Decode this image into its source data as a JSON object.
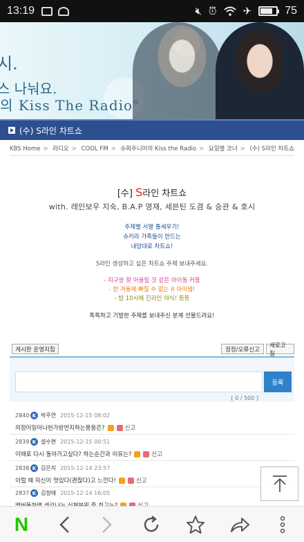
{
  "status_bar": {
    "time": "13:19",
    "battery_level": 75,
    "battery_text": "75",
    "icons": [
      "image-icon",
      "notification-icon",
      "mute-icon",
      "alarm-icon",
      "wifi-icon",
      "airplane-icon",
      "battery-icon"
    ]
  },
  "banner": {
    "line1": "시.",
    "line2": "스 나눠요.",
    "line3": "의 Kiss The Radio\""
  },
  "title_bar": {
    "label": "(수) S라인 차트쇼"
  },
  "breadcrumb": [
    "KBS Home",
    "라디오",
    "COOL FM",
    "슈퍼주니어의 Kiss the Radio",
    "요일별 코너",
    "(수) S라인 차트쇼"
  ],
  "content": {
    "title_prefix": "[수] ",
    "title_s": "S",
    "title_rest": "라인 차트쇼",
    "subtitle": "with. 레인보우 지숙, B.A.P 영재, 세븐틴 도겸 & 승관 & 호시",
    "desc1": "주제별 서열 줄세우기!",
    "desc2": "슈키라 가족들이 만드는",
    "desc3": "내맘대로 차트쇼!",
    "invite": "S라인 생성하고 싶은 차트쇼 주제 보내주세요.",
    "ex1": "- 지구랑 잘 어울릴 것 같은 아이돌 커플",
    "ex2": "- 한 겨울에 빠질 수 없는 it 아이템!",
    "ex3": "- 밤 10시에 진리인 야식! 등등",
    "closing": "톡톡하고 기발한 주제를 보내주신 분께 선물드려요!"
  },
  "board": {
    "rules_btn": "게시판 운영지침",
    "correction_btn": "정정/오류신고",
    "refresh_btn": "새로고침",
    "submit_btn": "등록",
    "counter": "[ 0 / 500 ]"
  },
  "comments": [
    {
      "num": "2840",
      "badge": "K",
      "name": "박주연",
      "date": "2015-12-15 08:02",
      "text": "의정어일어나헌가랑먼지하는뭉둥은?",
      "report": "신고"
    },
    {
      "num": "2839",
      "badge": "K",
      "name": "설수현",
      "date": "2015-12-15 00:51",
      "text": "이때로 다시 돌아가고싶다? 하는순간과 이유는?",
      "report": "신고"
    },
    {
      "num": "2838",
      "badge": "K",
      "name": "김은지",
      "date": "2015-12-14 23:57",
      "text": "이럴 때 자신이 멋있다(괜찮다)고 느낀다!",
      "report": "신고"
    },
    {
      "num": "2837",
      "badge": "K",
      "name": "김정애",
      "date": "2015-12-14 16:05",
      "text": "멤버들하면 생각나는 신체부위 중 최고는?",
      "report": "신고"
    }
  ],
  "bottom_nav": {
    "n_logo": "N",
    "icons": [
      "naver-logo",
      "back-icon",
      "forward-icon",
      "refresh-icon",
      "bookmark-star-icon",
      "share-icon",
      "more-icon"
    ]
  }
}
